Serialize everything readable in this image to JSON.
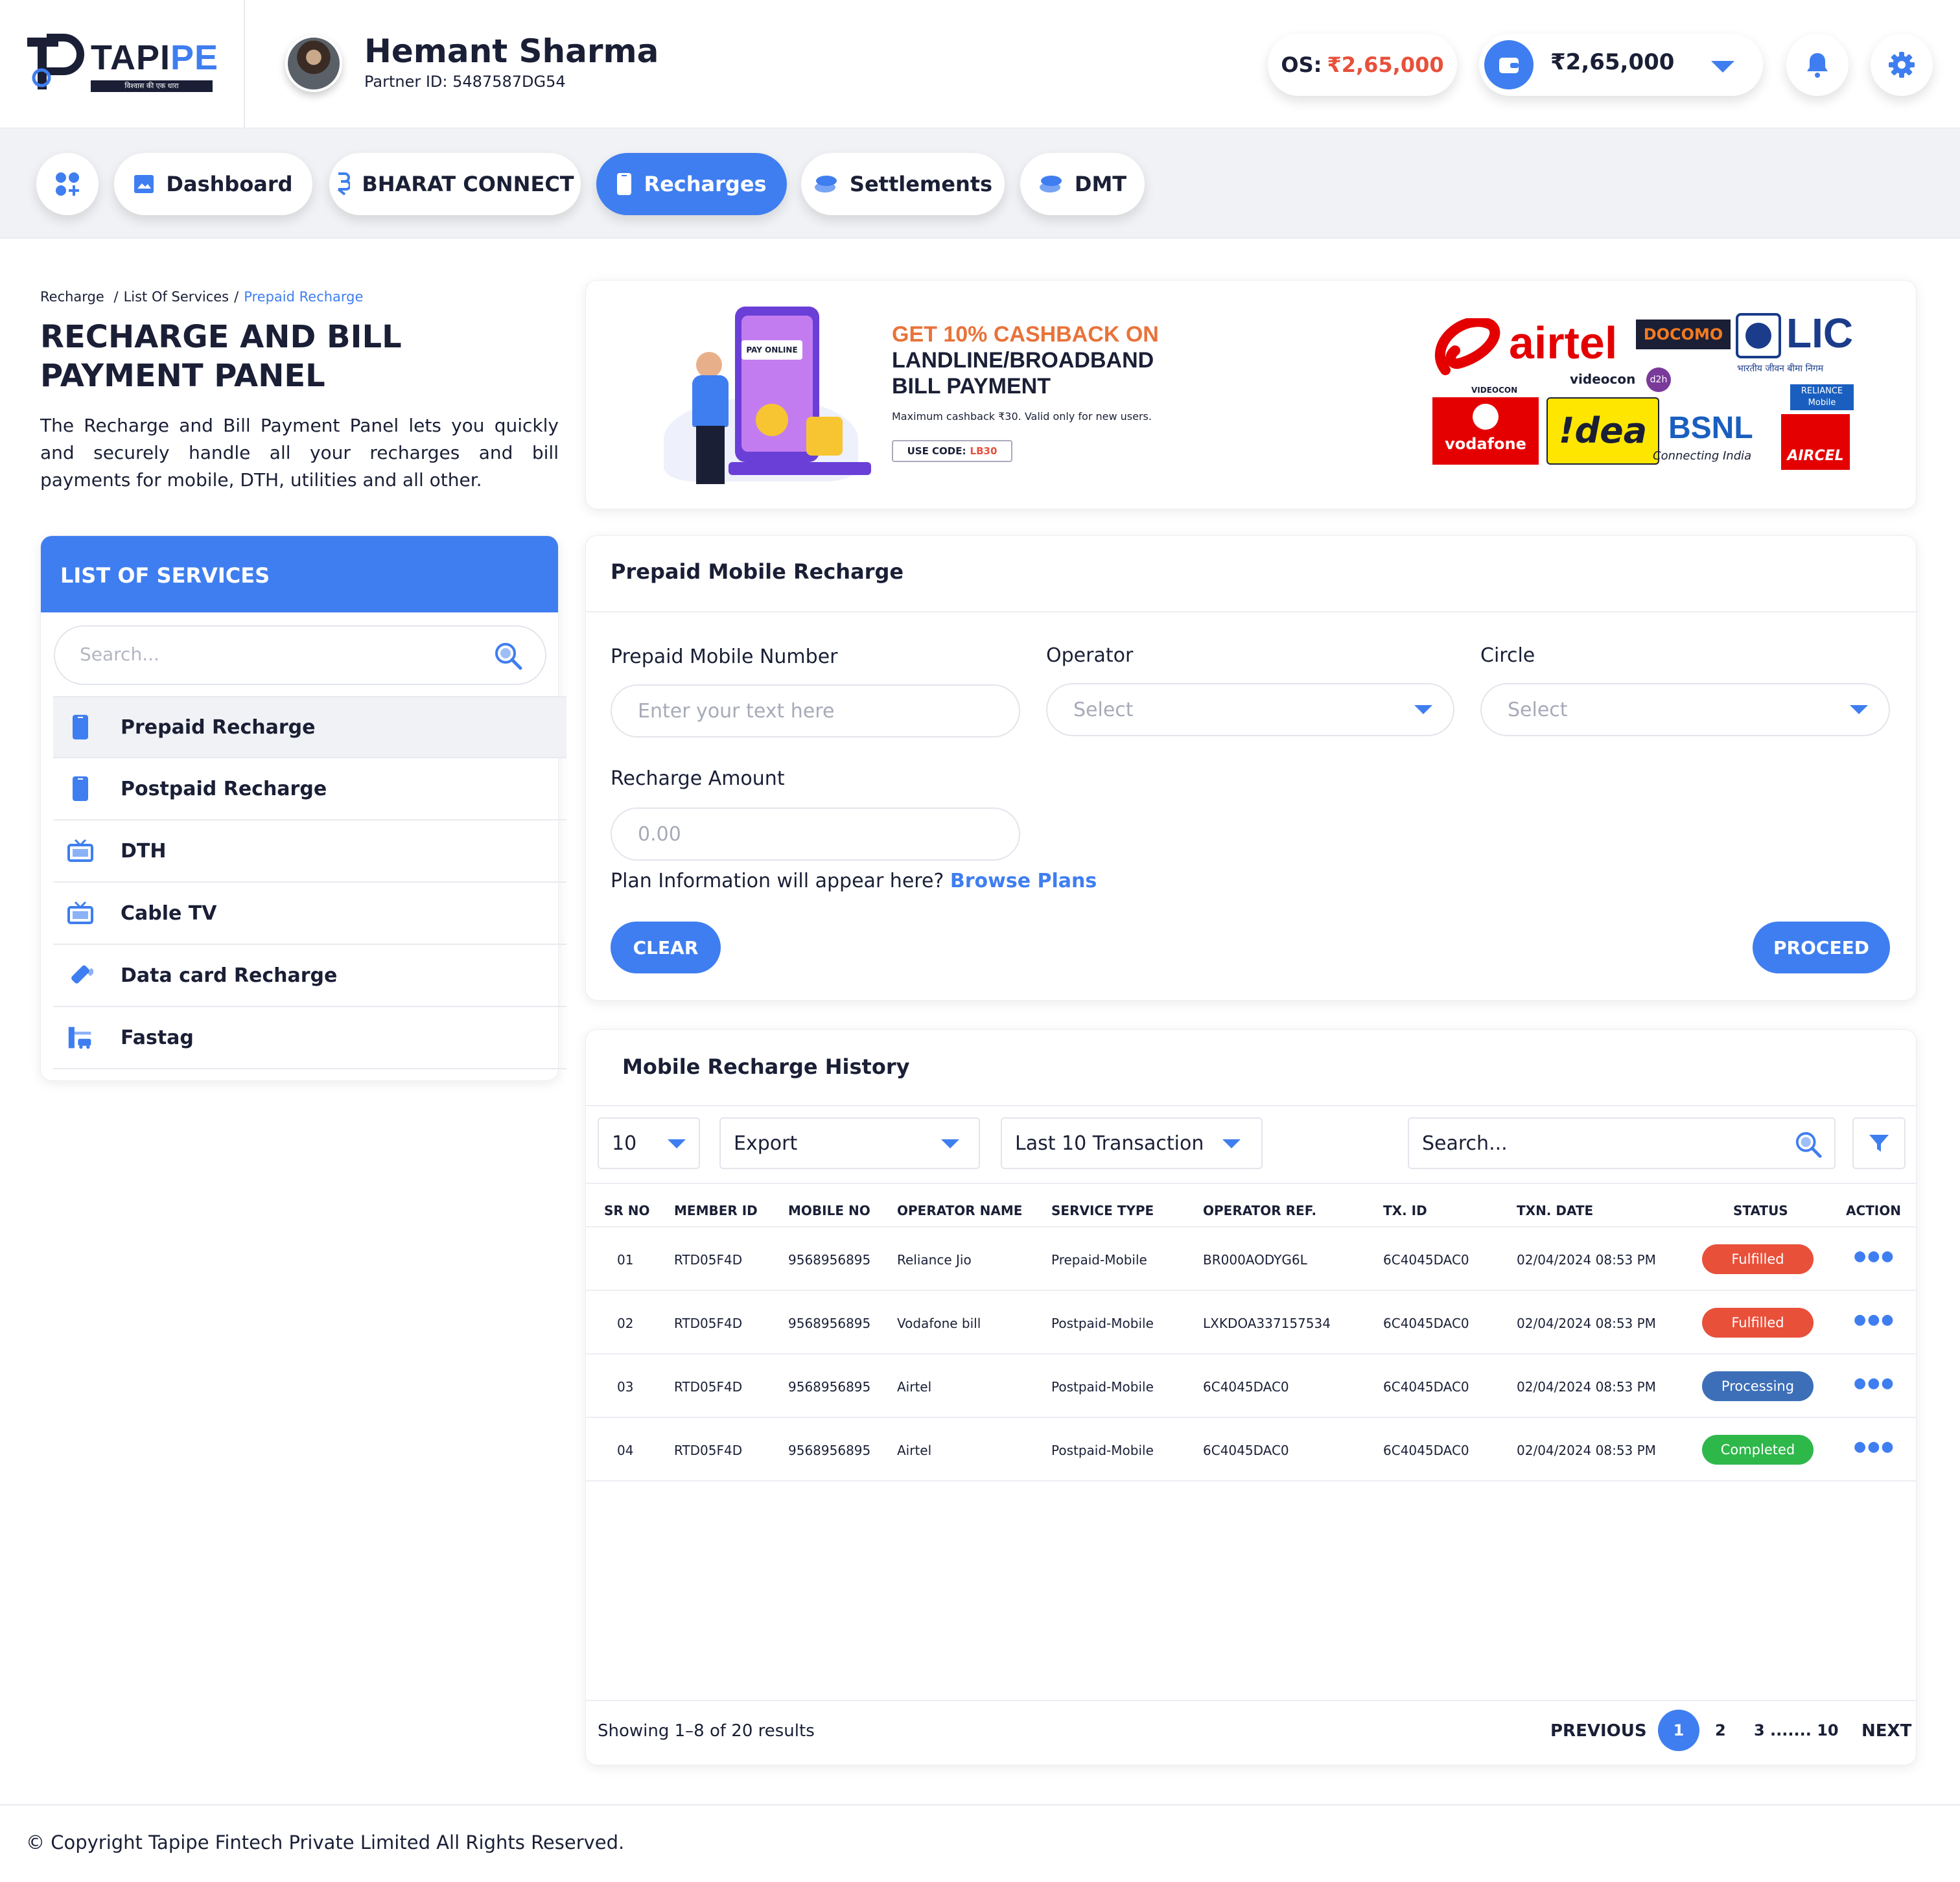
{
  "brand": {
    "name_part1": "TAPI",
    "name_part2": "PE",
    "tagline": "विश्वास की एक धारा"
  },
  "user": {
    "name": "Hemant Sharma",
    "partner_id": "Partner ID: 5487587DG54"
  },
  "header": {
    "os_label": "OS:",
    "os_value": "₹2,65,000",
    "wallet_value": "₹2,65,000"
  },
  "nav": {
    "items": [
      {
        "label": "Dashboard"
      },
      {
        "label": "BHARAT CONNECT"
      },
      {
        "label": "Recharges"
      },
      {
        "label": "Settlements"
      },
      {
        "label": "DMT"
      }
    ]
  },
  "breadcrumb": {
    "item1": "Recharge",
    "item2": "List Of Services",
    "item3": "Prepaid Recharge"
  },
  "page": {
    "title_line1": "RECHARGE AND BILL",
    "title_line2": "PAYMENT PANEL",
    "description": "The Recharge and Bill Payment Panel lets you quickly and securely handle all your recharges and bill payments for mobile, DTH, utilities and all other."
  },
  "services": {
    "header": "LIST OF SERVICES",
    "search_placeholder": "Search...",
    "items": [
      {
        "label": "Prepaid Recharge"
      },
      {
        "label": "Postpaid Recharge"
      },
      {
        "label": "DTH"
      },
      {
        "label": "Cable TV"
      },
      {
        "label": "Data card Recharge"
      },
      {
        "label": "Fastag"
      }
    ]
  },
  "banner": {
    "pay_online": "PAY ONLINE",
    "line1": "GET 10% CASHBACK ON",
    "line2": "LANDLINE/BROADBAND",
    "line3": "BILL PAYMENT",
    "note": "Maximum cashback ₹30. Valid only for new users.",
    "code_label": "USE CODE:",
    "code": "LB30",
    "logos": {
      "airtel": "airtel",
      "docomo": "DOCOMO",
      "lic": "LIC",
      "lic_sub": "भारतीय जीवन बीमा निगम",
      "videocon": "VIDEOCON",
      "videocon2": "videocon",
      "d2h": "d2h",
      "reliance": "RELIANCE Mobile",
      "vodafone": "vodafone",
      "idea": "!dea",
      "bsnl": "BSNL",
      "bsnl_sub": "Connecting India",
      "aircel": "AIRCEL"
    }
  },
  "form": {
    "title": "Prepaid Mobile Recharge",
    "mobile_label": "Prepaid Mobile Number",
    "mobile_placeholder": "Enter your text here",
    "operator_label": "Operator",
    "operator_value": "Select",
    "circle_label": "Circle",
    "circle_value": "Select",
    "amount_label": "Recharge Amount",
    "amount_placeholder": "0.00",
    "plan_text": "Plan Information will appear here?",
    "plan_link": "Browse Plans",
    "clear": "CLEAR",
    "proceed": "PROCEED"
  },
  "history": {
    "title": "Mobile Recharge History",
    "page_size": "10",
    "export": "Export",
    "range": "Last 10 Transaction",
    "search_placeholder": "Search...",
    "columns": [
      "SR NO",
      "MEMBER ID",
      "MOBILE NO",
      "OPERATOR NAME",
      "SERVICE TYPE",
      "OPERATOR REF.",
      "TX. ID",
      "TXN. DATE",
      "STATUS",
      "ACTION"
    ],
    "rows": [
      {
        "sr": "01",
        "member": "RTD05F4D",
        "mobile": "9568956895",
        "operator": "Reliance Jio",
        "service": "Prepaid-Mobile",
        "ref": "BR000AODYG6L",
        "tx": "6C4045DAC0",
        "date": "02/04/2024 08:53 PM",
        "status": "Fulfilled",
        "status_color": "#e8503a"
      },
      {
        "sr": "02",
        "member": "RTD05F4D",
        "mobile": "9568956895",
        "operator": "Vodafone bill",
        "service": "Postpaid-Mobile",
        "ref": "LXKDOA337157534",
        "tx": "6C4045DAC0",
        "date": "02/04/2024 08:53 PM",
        "status": "Fulfilled",
        "status_color": "#e8503a"
      },
      {
        "sr": "03",
        "member": "RTD05F4D",
        "mobile": "9568956895",
        "operator": "Airtel",
        "service": "Postpaid-Mobile",
        "ref": "6C4045DAC0",
        "tx": "6C4045DAC0",
        "date": "02/04/2024 08:53 PM",
        "status": "Processing",
        "status_color": "#3d6fb8"
      },
      {
        "sr": "04",
        "member": "RTD05F4D",
        "mobile": "9568956895",
        "operator": "Airtel",
        "service": "Postpaid-Mobile",
        "ref": "6C4045DAC0",
        "tx": "6C4045DAC0",
        "date": "02/04/2024 08:53 PM",
        "status": "Completed",
        "status_color": "#2fb84a"
      }
    ],
    "showing": "Showing 1–8 of 20 results",
    "previous": "PREVIOUS",
    "pages": [
      "1",
      "2",
      "3 ....... 10"
    ],
    "next": "NEXT"
  },
  "footer": {
    "copyright": "© Copyright Tapipe Fintech Private Limited All Rights Reserved."
  },
  "colors": {
    "accent": "#3f7ef0",
    "danger": "#e8503a",
    "dark": "#1a1f36"
  }
}
